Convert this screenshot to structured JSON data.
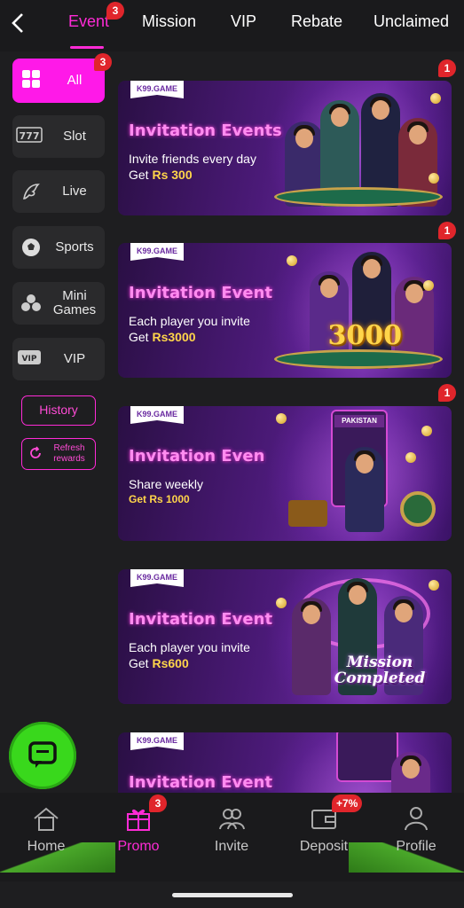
{
  "colors": {
    "accent": "#ff2bd6",
    "badge": "#e0252b",
    "background": "#1e1e20",
    "chat": "#39d81c"
  },
  "top_tabs": [
    {
      "label": "Event",
      "active": true,
      "badge": "3"
    },
    {
      "label": "Mission",
      "active": false
    },
    {
      "label": "VIP",
      "active": false
    },
    {
      "label": "Rebate",
      "active": false
    },
    {
      "label": "Unclaimed",
      "active": false
    }
  ],
  "sidebar": {
    "items": [
      {
        "label": "All",
        "icon": "grid-icon",
        "active": true,
        "badge": "3"
      },
      {
        "label": "Slot",
        "icon": "slot-777-icon",
        "active": false
      },
      {
        "label": "Live",
        "icon": "dragon-icon",
        "active": false
      },
      {
        "label": "Sports",
        "icon": "soccer-ball-icon",
        "active": false
      },
      {
        "label": "Mini\nGames",
        "icon": "cards-icon",
        "active": false
      },
      {
        "label": "VIP",
        "icon": "vip-card-icon",
        "active": false
      }
    ],
    "history_label": "History",
    "refresh_label": "Refresh\nrewards"
  },
  "banners": [
    {
      "brand": "K99.GAME",
      "title": "Invitation Events",
      "line1": "Invite friends every day",
      "line2_prefix": "Get ",
      "amount": "Rs 300",
      "badge": "1"
    },
    {
      "brand": "K99.GAME",
      "title": "Invitation Event",
      "line1": "Each player you invite",
      "line2_prefix": "Get ",
      "amount": "Rs3000",
      "badge": "1",
      "art_text": "3000"
    },
    {
      "brand": "K99.GAME",
      "title": "Invitation Even",
      "line1": "Share weekly",
      "line2_prefix": "",
      "amount": "Get Rs 1000",
      "badge": "1",
      "art_text": "PAKISTAN"
    },
    {
      "brand": "K99.GAME",
      "title": "Invitation Event",
      "line1": "Each player you invite",
      "line2_prefix": "Get ",
      "amount": "Rs600",
      "art_text": "Mission Completed"
    },
    {
      "brand": "K99.GAME",
      "title": "Invitation Event"
    }
  ],
  "bottom_nav": [
    {
      "label": "Home",
      "icon": "home-icon",
      "active": false
    },
    {
      "label": "Promo",
      "icon": "gift-icon",
      "active": true,
      "badge": "3"
    },
    {
      "label": "Invite",
      "icon": "people-icon",
      "active": false
    },
    {
      "label": "Deposit",
      "icon": "wallet-icon",
      "active": false,
      "badge": "+7%"
    },
    {
      "label": "Profile",
      "icon": "user-icon",
      "active": false
    }
  ]
}
